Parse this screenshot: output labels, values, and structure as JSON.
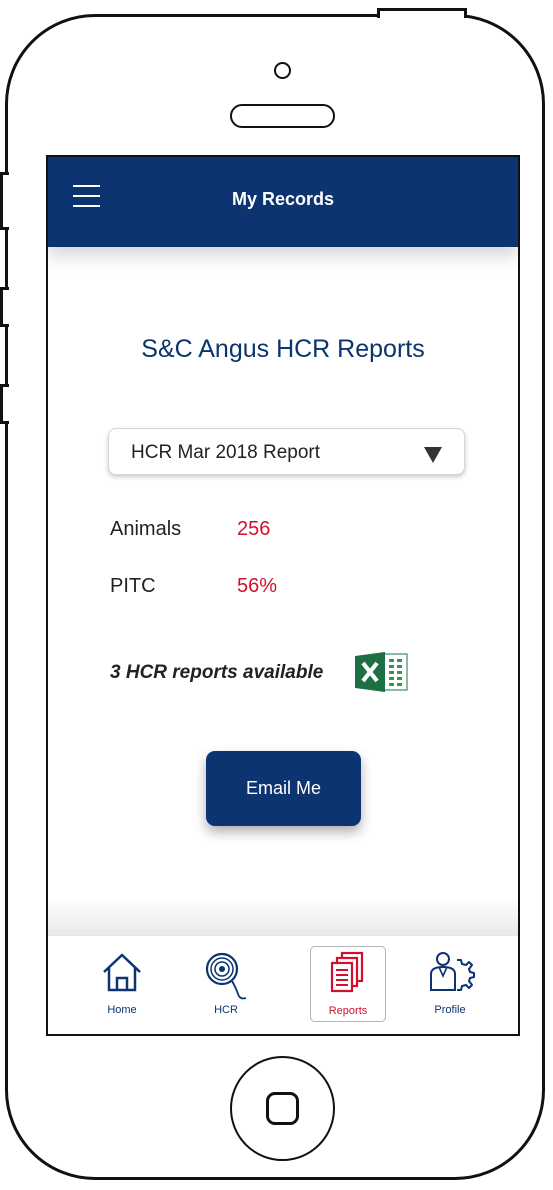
{
  "header": {
    "title": "My Records",
    "menu_icon": "hamburger-menu-icon"
  },
  "main": {
    "title": "S&C Angus HCR Reports",
    "report_select": {
      "selected": "HCR Mar 2018 Report",
      "icon": "dropdown-triangle-icon"
    },
    "stats": [
      {
        "label": "Animals",
        "value": "256"
      },
      {
        "label": "PITC",
        "value": "56%"
      }
    ],
    "reports_available": "3 HCR reports available",
    "excel_icon": "excel-icon",
    "email_button": "Email Me"
  },
  "nav": {
    "items": [
      {
        "label": "Home",
        "icon": "home-icon",
        "active": false
      },
      {
        "label": "HCR",
        "icon": "hcr-icon",
        "active": false
      },
      {
        "label": "Reports",
        "icon": "reports-icon",
        "active": true
      },
      {
        "label": "Profile",
        "icon": "profile-icon",
        "active": false
      }
    ]
  },
  "colors": {
    "primary": "#0b3470",
    "accent_red": "#d2102c",
    "excel_green": "#1d7044"
  }
}
